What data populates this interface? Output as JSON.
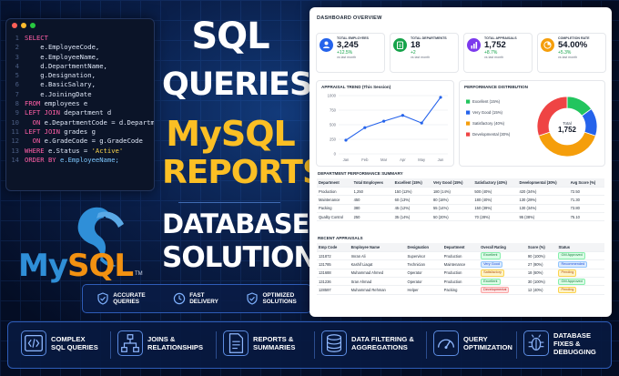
{
  "code_editor": {
    "lines": [
      {
        "num": "1",
        "parts": [
          [
            "kw",
            "SELECT"
          ]
        ]
      },
      {
        "num": "2",
        "parts": [
          [
            "tx",
            "    e.EmployeeCode,"
          ]
        ]
      },
      {
        "num": "3",
        "parts": [
          [
            "tx",
            "    e.EmployeeName,"
          ]
        ]
      },
      {
        "num": "4",
        "parts": [
          [
            "tx",
            "    d.DepartmentName,"
          ]
        ]
      },
      {
        "num": "5",
        "parts": [
          [
            "tx",
            "    g.Designation,"
          ]
        ]
      },
      {
        "num": "6",
        "parts": [
          [
            "tx",
            "    e.BasicSalary,"
          ]
        ]
      },
      {
        "num": "7",
        "parts": [
          [
            "tx",
            "    e.JoiningDate"
          ]
        ]
      },
      {
        "num": "8",
        "parts": [
          [
            "kw",
            "FROM "
          ],
          [
            "tx",
            "employees e"
          ]
        ]
      },
      {
        "num": "9",
        "parts": [
          [
            "kw",
            "LEFT JOIN "
          ],
          [
            "tx",
            "department d"
          ]
        ]
      },
      {
        "num": "10",
        "parts": [
          [
            "kw",
            "  ON "
          ],
          [
            "tx",
            "e.DepartmentCode = d.DepartmentCode"
          ]
        ]
      },
      {
        "num": "11",
        "parts": [
          [
            "kw",
            "LEFT JOIN "
          ],
          [
            "tx",
            "grades g"
          ]
        ]
      },
      {
        "num": "12",
        "parts": [
          [
            "kw",
            "  ON "
          ],
          [
            "tx",
            "e.GradeCode = g.GradeCode"
          ]
        ]
      },
      {
        "num": "13",
        "parts": [
          [
            "kw",
            "WHERE "
          ],
          [
            "tx",
            "e.Status = "
          ],
          [
            "st",
            "'Active'"
          ]
        ]
      },
      {
        "num": "14",
        "parts": [
          [
            "kw",
            "ORDER BY "
          ],
          [
            "fn",
            "e.EmployeeName;"
          ]
        ]
      }
    ],
    "dot_colors": [
      "#ff5f57",
      "#febc2e",
      "#28c840"
    ]
  },
  "logo": {
    "my": "My",
    "sql": "SQL",
    "tm": "TM"
  },
  "headline": {
    "line1": "SQL",
    "line2": "QUERIES",
    "line3": "MySQL",
    "line4": "REPORTS",
    "line5": "DATABASE",
    "line6": "SOLUTIONS"
  },
  "badges": [
    {
      "icon": "shield-check-icon",
      "l1": "ACCURATE",
      "l2": "QUERIES"
    },
    {
      "icon": "clock-icon",
      "l1": "FAST",
      "l2": "DELIVERY"
    },
    {
      "icon": "shield-check-icon",
      "l1": "OPTIMIZED",
      "l2": "SOLUTIONS"
    }
  ],
  "dashboard": {
    "title": "DASHBOARD OVERVIEW",
    "kpis": [
      {
        "label": "TOTAL EMPLOYEES",
        "value": "3,245",
        "change": "+12.5%",
        "note": "vs last month",
        "color": "#2563eb",
        "icon": "users-icon"
      },
      {
        "label": "TOTAL DEPARTMENTS",
        "value": "18",
        "change": "+2",
        "note": "vs last month",
        "color": "#16a34a",
        "icon": "clipboard-icon"
      },
      {
        "label": "TOTAL APPRAISALS",
        "value": "1,752",
        "change": "+8.7%",
        "note": "vs last month",
        "color": "#7c3aed",
        "icon": "bar-chart-icon"
      },
      {
        "label": "COMPLETION RATE",
        "value": "54.00%",
        "change": "+5.3%",
        "note": "vs last month",
        "color": "#f59e0b",
        "icon": "pie-chart-icon"
      }
    ],
    "trend_title": "APPRAISAL TREND (This Session)",
    "dist_title": "PERFORMANCE DISTRIBUTION",
    "dept_title": "DEPARTMENT PERFORMANCE SUMMARY",
    "dept_headers": [
      "Department",
      "Total Employees",
      "Excellent (15%)",
      "Very Good (15%)",
      "Satisfactory (40%)",
      "Developmental (30%)",
      "Avg Score (%)"
    ],
    "dept_rows": [
      [
        "Production",
        "1,250",
        "150 (12%)",
        "180 (14%)",
        "500 (40%)",
        "420 (34%)",
        "72.50"
      ],
      [
        "Maintenance",
        "450",
        "60 (13%)",
        "80 (18%)",
        "180 (40%)",
        "130 (29%)",
        "71.30"
      ],
      [
        "Packing",
        "380",
        "45 (12%)",
        "55 (14%)",
        "150 (39%)",
        "130 (34%)",
        "73.80"
      ],
      [
        "Quality Control",
        "250",
        "35 (14%)",
        "50 (20%)",
        "70 (28%)",
        "95 (38%)",
        "75.10"
      ]
    ],
    "recent_title": "RECENT APPRAISALS",
    "recent_headers": [
      "Emp Code",
      "Employee Name",
      "Designation",
      "Department",
      "Overall Rating",
      "Score (%)",
      "Status"
    ],
    "recent_rows": [
      [
        "131872",
        "Imran Ali",
        "Supervisor",
        "Production",
        "Excellent",
        "90 (100%)",
        "GM Approved"
      ],
      [
        "131785",
        "Kashif Liaqat",
        "Technician",
        "Maintenance",
        "Very Good",
        "27 (90%)",
        "Recommended"
      ],
      [
        "131688",
        "Muhammad Ahmed",
        "Operator",
        "Production",
        "Satisfactory",
        "18 (60%)",
        "Pending"
      ],
      [
        "131236",
        "Sran Ahmad",
        "Operator",
        "Production",
        "Excellent",
        "30 (100%)",
        "GM Approved"
      ],
      [
        "128597",
        "Muhammad Rehman",
        "Helper",
        "Packing",
        "Developmental",
        "12 (40%)",
        "Pending"
      ]
    ]
  },
  "chart_data": [
    {
      "type": "line",
      "title": "APPRAISAL TREND (This Session)",
      "categories": [
        "Jan",
        "Feb",
        "Mar",
        "Apr",
        "May",
        "Jun"
      ],
      "x": [
        "Jan",
        "Feb",
        "Mar",
        "Apr",
        "May",
        "Jun"
      ],
      "series": [
        {
          "values": [
            235,
            450,
            560,
            660,
            530,
            970
          ]
        }
      ],
      "yticks": [
        0,
        250,
        500,
        750,
        1000
      ],
      "ylim": [
        0,
        1000
      ],
      "grid": true,
      "color": "#2563eb"
    },
    {
      "type": "pie",
      "title": "PERFORMANCE DISTRIBUTION",
      "labels": [
        "Excellent (15%)",
        "Very Good (15%)",
        "Satisfactory (40%)",
        "Developmental (30%)"
      ],
      "values": [
        15,
        15,
        40,
        30
      ],
      "colors": [
        "#22c55e",
        "#2563eb",
        "#f59e0b",
        "#ef4444"
      ],
      "center_label": "Total",
      "center_value": "1,752",
      "legend": "left"
    }
  ],
  "features": [
    {
      "icon": "code-icon",
      "l1": "COMPLEX",
      "l2": "SQL QUERIES"
    },
    {
      "icon": "hierarchy-icon",
      "l1": "JOINS &",
      "l2": "RELATIONSHIPS"
    },
    {
      "icon": "document-icon",
      "l1": "REPORTS &",
      "l2": "SUMMARIES"
    },
    {
      "icon": "database-icon",
      "l1": "DATA FILTERING &",
      "l2": "AGGREGATIONS"
    },
    {
      "icon": "gauge-icon",
      "l1": "QUERY",
      "l2": "OPTIMIZATION"
    },
    {
      "icon": "bug-icon",
      "l1": "DATABASE",
      "l2": "FIXES & DEBUGGING"
    }
  ]
}
